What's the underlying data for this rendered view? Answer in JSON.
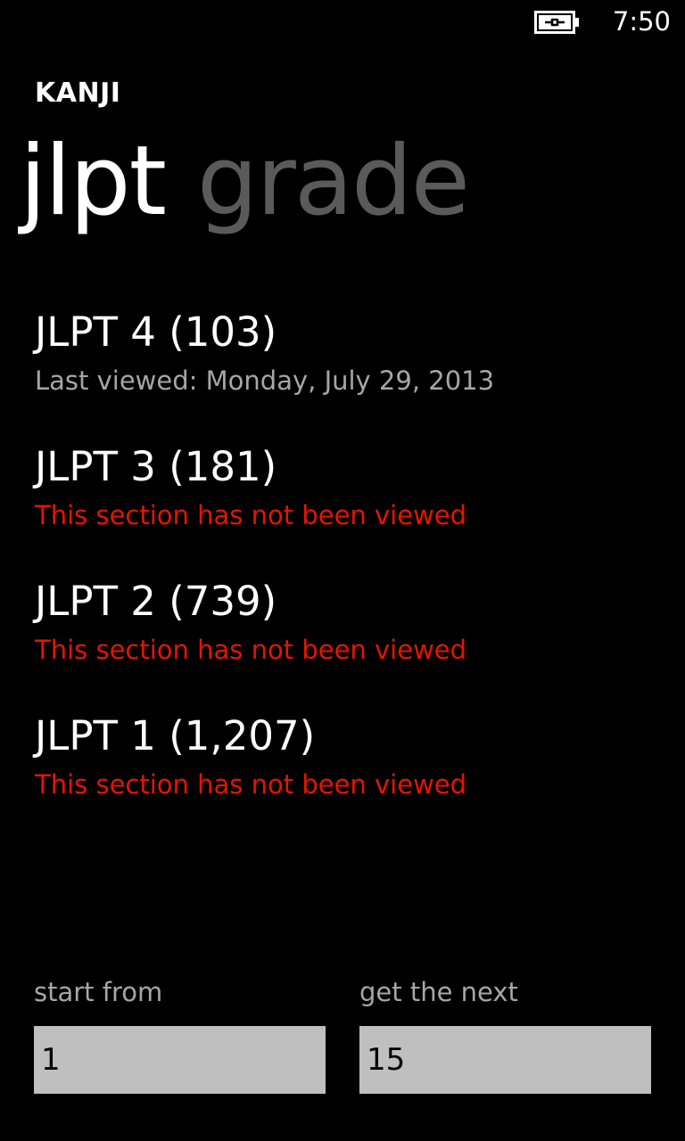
{
  "status_bar": {
    "time": "7:50",
    "battery_icon": "battery-charging-icon"
  },
  "app": {
    "title": "KANJI"
  },
  "pivot": {
    "items": [
      {
        "label": "jlpt",
        "active": true
      },
      {
        "label": "grade",
        "active": false
      }
    ]
  },
  "sections": [
    {
      "title": "JLPT 4 (103)",
      "subtitle": "Last viewed: Monday, July 29, 2013",
      "viewed": true
    },
    {
      "title": "JLPT 3 (181)",
      "subtitle": "This section has not been viewed",
      "viewed": false
    },
    {
      "title": "JLPT 2 (739)",
      "subtitle": "This section has not been viewed",
      "viewed": false
    },
    {
      "title": "JLPT 1 (1,207)",
      "subtitle": "This section has not been viewed",
      "viewed": false
    }
  ],
  "controls": {
    "start_from": {
      "label": "start from",
      "value": "1"
    },
    "get_next": {
      "label": "get the next",
      "value": "15"
    }
  },
  "colors": {
    "background": "#000000",
    "viewed_text": "#a6a6a6",
    "not_viewed_text": "#e51400",
    "inactive_pivot": "#5a5a5a",
    "input_background": "#bfbfbf"
  }
}
